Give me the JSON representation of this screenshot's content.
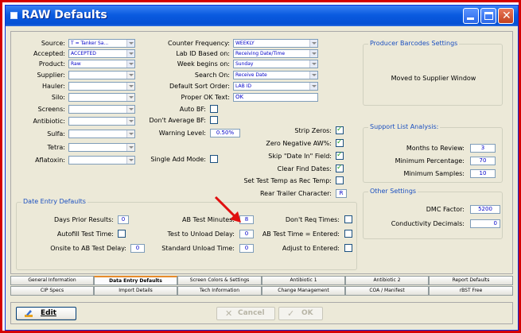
{
  "window": {
    "title": "RAW Defaults"
  },
  "left": {
    "source": {
      "label": "Source:",
      "value": "T = Tanker Sa..."
    },
    "accepted": {
      "label": "Accepted:",
      "value": "ACCEPTED"
    },
    "product": {
      "label": "Product:",
      "value": "Raw"
    },
    "supplier": {
      "label": "Supplier:",
      "value": ""
    },
    "hauler": {
      "label": "Hauler:",
      "value": ""
    },
    "silo": {
      "label": "Silo:",
      "value": ""
    },
    "screens": {
      "label": "Screens:",
      "value": ""
    },
    "antibiotic": {
      "label": "Antibiotic:",
      "value": ""
    },
    "sulfa": {
      "label": "Sulfa:",
      "value": ""
    },
    "tetra": {
      "label": "Tetra:",
      "value": ""
    },
    "aflatoxin": {
      "label": "Aflatoxin:",
      "value": ""
    }
  },
  "middle": {
    "counter_frequency": {
      "label": "Counter Frequency:",
      "value": "WEEKLY"
    },
    "lab_id_based_on": {
      "label": "Lab ID Based on:",
      "value": "Receiving Date/Time"
    },
    "week_begins_on": {
      "label": "Week begins on:",
      "value": "Sunday"
    },
    "search_on": {
      "label": "Search On:",
      "value": "Receive Date"
    },
    "default_sort_order": {
      "label": "Default Sort Order:",
      "value": "LAB ID"
    },
    "proper_ok_text": {
      "label": "Proper OK Text:",
      "value": "OK"
    },
    "auto_bf": {
      "label": "Auto BF:",
      "checked": false
    },
    "dont_average_bf": {
      "label": "Don't Average BF:",
      "checked": false
    },
    "warning_level": {
      "label": "Warning Level:",
      "value": "0.50%"
    },
    "single_add_mode": {
      "label": "Single Add Mode:",
      "checked": false
    }
  },
  "right_options": {
    "strip_zeros": {
      "label": "Strip Zeros:",
      "checked": true
    },
    "zero_negative_aw": {
      "label": "Zero Negative AW%:",
      "checked": true
    },
    "skip_date_in_field": {
      "label": "Skip \"Date In\" Field:",
      "checked": true
    },
    "clear_find_dates": {
      "label": "Clear Find Dates:",
      "checked": true
    },
    "set_test_temp": {
      "label": "Set Test Temp as Rec Temp:",
      "checked": false
    },
    "rear_trailer_character": {
      "label": "Rear Trailer Character:",
      "value": "R"
    }
  },
  "producer_barcodes": {
    "title": "Producer Barcodes Settings",
    "text": "Moved to Supplier Window"
  },
  "support_list": {
    "title": "Support List Analysis:",
    "months_to_review": {
      "label": "Months to Review:",
      "value": "3"
    },
    "minimum_percentage": {
      "label": "Minimum Percentage:",
      "value": "70"
    },
    "minimum_samples": {
      "label": "Minimum Samples:",
      "value": "10"
    }
  },
  "other_settings": {
    "title": "Other Settings",
    "dmc_factor": {
      "label": "DMC Factor:",
      "value": "5200"
    },
    "conductivity_decimals": {
      "label": "Conductivity Decimals:",
      "value": "0"
    }
  },
  "date_entry": {
    "title": "Date Entry Defaults",
    "days_prior_results": {
      "label": "Days Prior Results:",
      "value": "0"
    },
    "autofill_test_time": {
      "label": "Autofill Test Time:",
      "checked": false
    },
    "onsite_to_ab_test_delay": {
      "label": "Onsite to AB Test Delay:",
      "value": "0"
    },
    "ab_test_minutes": {
      "label": "AB Test Minutes:",
      "value": "8"
    },
    "test_to_unload_delay": {
      "label": "Test to Unload Delay:",
      "value": "0"
    },
    "standard_unload_time": {
      "label": "Standard Unload Time:",
      "value": "0"
    },
    "dont_req_times": {
      "label": "Don't Req Times:",
      "checked": false
    },
    "ab_test_time_entered": {
      "label": "AB Test Time = Entered:",
      "checked": false
    },
    "adjust_to_entered": {
      "label": "Adjust to Entered:",
      "checked": false
    }
  },
  "tabs_row1": [
    "General Information",
    "Data Entry Defaults",
    "Screen Colors & Settings",
    "Antibiotic 1",
    "Antibiotic 2",
    "Report Defaults"
  ],
  "tabs_row2": [
    "CIP Specs",
    "Import Details",
    "Tech Information",
    "Change Management",
    "COA / Manifest",
    "rBST Free"
  ],
  "buttons": {
    "edit": "Edit",
    "cancel": "Cancel",
    "ok": "OK"
  },
  "colors": {
    "accent_red": "#d40000",
    "title_blue": "#0a5be0",
    "value_blue": "#0000c8",
    "check_green": "#21a121",
    "group_title": "#1a4fc0"
  },
  "icons": [
    "window-icon",
    "minimize-icon",
    "maximize-icon",
    "close-icon",
    "dropdown-arrow-icon",
    "checkmark-icon",
    "edit-icon",
    "cancel-x-icon",
    "ok-check-icon",
    "red-arrow-annotation"
  ]
}
